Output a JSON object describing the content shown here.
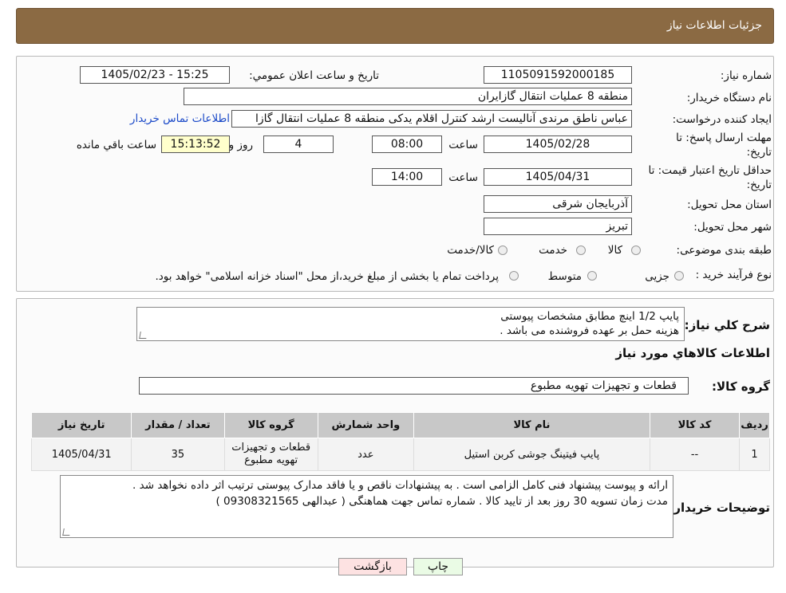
{
  "header": {
    "title": "جزئیات اطلاعات نیاز"
  },
  "form": {
    "need_number_label": "شماره نیاز:",
    "need_number": "1105091592000185",
    "announce_label": "تاریخ و ساعت اعلان عمومي:",
    "announce_value": "1405/02/23 - 15:25",
    "buyer_org_label": "نام دستگاه خريدار:",
    "buyer_org": "منطقه 8 عملیات انتقال گازایران",
    "creator_label": "ايجاد کننده درخواست:",
    "creator": "عباس ناطق مرندی آنالیست ارشد کنترل اقلام یدکی منطقه 8 عملیات انتقال گازا",
    "contact_link": "اطلاعات تماس خریدار",
    "deadline_label_1": "مهلت ارسال پاسخ: تا",
    "deadline_label_2": "تاريخ:",
    "deadline_date": "1405/02/28",
    "time_word": "ساعت",
    "deadline_time": "08:00",
    "days_value": "4",
    "days_word": "روز و",
    "remaining_time": "15:13:52",
    "remaining_label": "ساعت باقي مانده",
    "validity_label_1": "حداقل تاريخ اعتبار قيمت: تا",
    "validity_label_2": "تاريخ:",
    "validity_date": "1405/04/31",
    "validity_time": "14:00",
    "province_label": "استان محل تحويل:",
    "province": "آذربایجان شرقی",
    "city_label": "شهر محل تحويل:",
    "city": "تبریز",
    "category_label": "طبقه بندی موضوعی:",
    "category_options": [
      "کالا",
      "خدمت",
      "کالا/خدمت"
    ],
    "process_label": "نوع فرآيند خريد :",
    "process_options": [
      "جزیی",
      "متوسط"
    ],
    "process_note": "پرداخت تمام یا بخشی از مبلغ خرید،از محل \"اسناد خزانه اسلامی\" خواهد بود."
  },
  "summary": {
    "desc_label": "شرح کلي نياز:",
    "desc_line1": "پایپ 1/2 اینچ مطابق مشخصات پیوستی",
    "desc_line2": "هزینه حمل بر عهده فروشنده می باشد .",
    "goods_info_title": "اطلاعات کالاهاي مورد نياز",
    "group_label": "گروه کالا:",
    "group_value": "قطعات و تجهیزات تهویه مطبوع"
  },
  "table": {
    "headers": [
      "رديف",
      "کد کالا",
      "نام کالا",
      "واحد شمارش",
      "گروه کالا",
      "تعداد / مقدار",
      "تاريخ نياز"
    ],
    "rows": [
      [
        "1",
        "--",
        "پایپ فیتینگ جوشی کربن استیل",
        "عدد",
        "قطعات و تجهیزات تهویه مطبوع",
        "35",
        "1405/04/31"
      ]
    ]
  },
  "notes": {
    "label": "توضيحات خريدار:",
    "line1": "ارائه و پیوست پیشنهاد فنی کامل الزامی است . به پیشنهادات ناقص  و یا فاقد مدارک پیوستی ترتیب اثر داده نخواهد شد .",
    "line2": "مدت زمان تسویه 30 روز بعد از تایید کالا . شماره تماس جهت هماهنگی ( عبدالهی 09308321565 )"
  },
  "buttons": {
    "print": "چاپ",
    "back": "بازگشت"
  },
  "colors": {
    "header_bg": "#8b6a43",
    "highlight": "#ffffcc",
    "link": "#1a49c8"
  }
}
